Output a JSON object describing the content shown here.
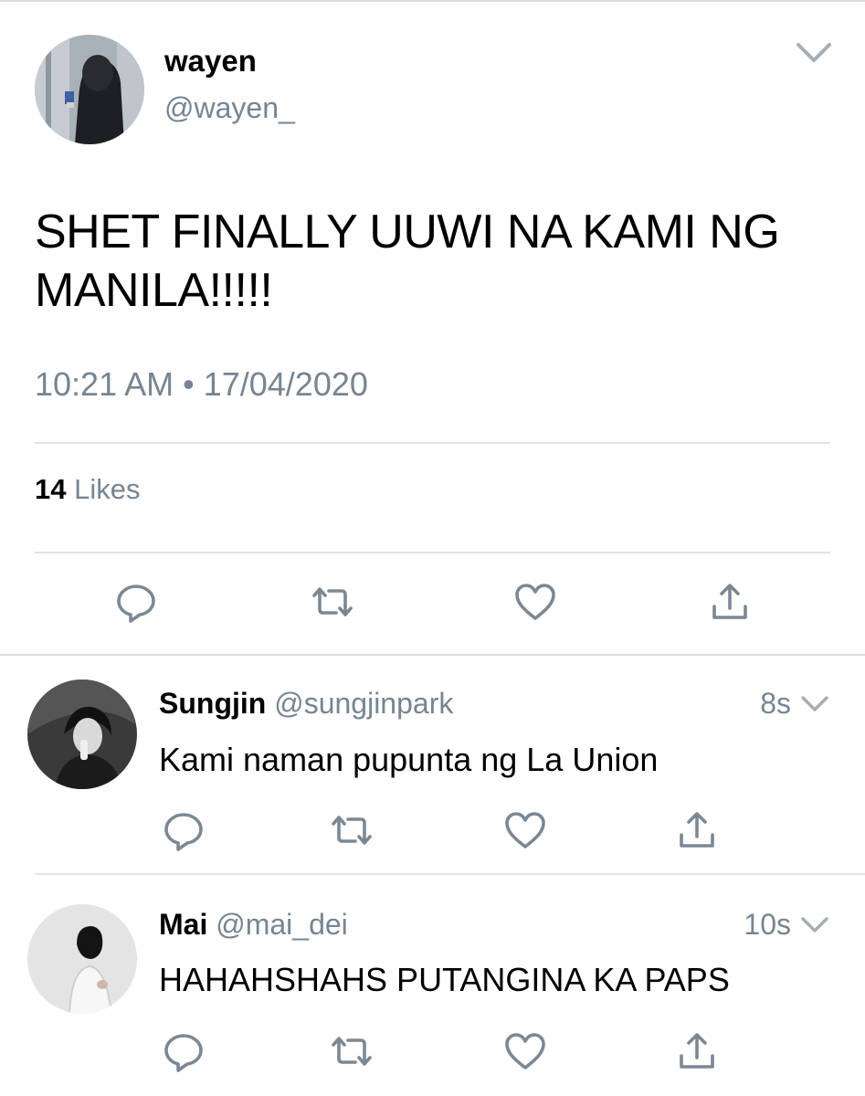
{
  "main_tweet": {
    "name": "wayen",
    "handle": "@wayen_",
    "text": "SHET FINALLY UUWI NA KAMI NG MANILA!!!!!",
    "time": "10:21 AM • 17/04/2020",
    "likes_count": "14",
    "likes_label": "Likes",
    "actions": [
      "reply-icon",
      "retweet-icon",
      "like-icon",
      "share-icon"
    ]
  },
  "replies": [
    {
      "name": "Sungjin",
      "handle": "@sungjinpark",
      "time": "8s",
      "text": "Kami naman pupunta ng La Union"
    },
    {
      "name": "Mai",
      "handle": "@mai_dei",
      "time": "10s",
      "text": "HAHAHSHAHS PUTANGINA KA PAPS"
    }
  ],
  "colors": {
    "secondary_text": "#768591",
    "icon_stroke": "#7b8893",
    "divider": "#dfe3e7"
  }
}
